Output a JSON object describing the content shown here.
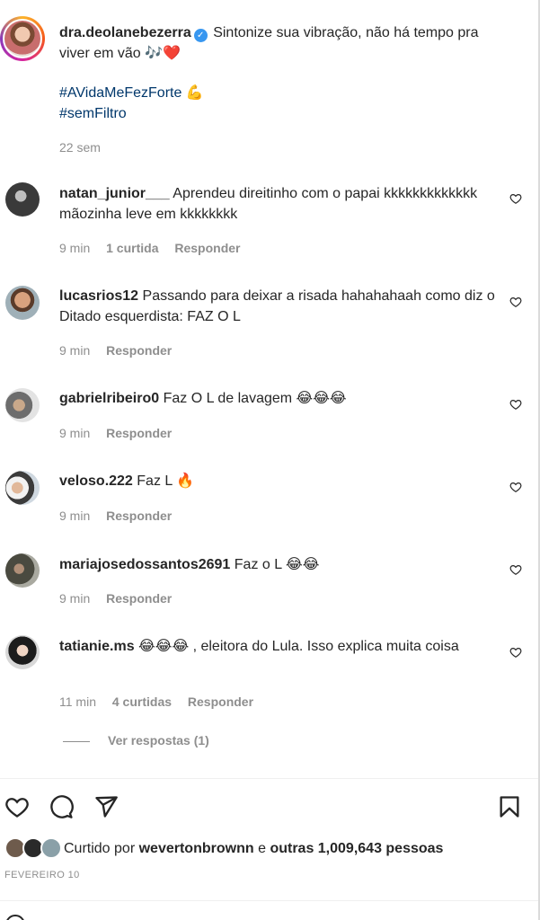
{
  "caption": {
    "username": "dra.deolanebezerra",
    "text": "Sintonize sua vibração, não há tempo pra viver em vão 🎶❤️",
    "hashtags": [
      "#AVidaMeFezForte 💪",
      "#semFiltro"
    ],
    "time": "22 sem"
  },
  "comments": [
    {
      "username": "natan_junior___",
      "text": "Aprendeu direitinho com o papai kkkkkkkkkkkkk mãozinha leve em kkkkkkkk",
      "time": "9 min",
      "likes": "1 curtida",
      "reply": "Responder"
    },
    {
      "username": "lucasrios12",
      "text": "Passando para deixar a risada hahahahaah como diz o Ditado esquerdista: FAZ O L",
      "time": "9 min",
      "likes": "",
      "reply": "Responder"
    },
    {
      "username": "gabrielribeiro0",
      "text": "Faz O L de lavagem 😂😂😂",
      "time": "9 min",
      "likes": "",
      "reply": "Responder"
    },
    {
      "username": "veloso.222",
      "text": "Faz L 🔥",
      "time": "9 min",
      "likes": "",
      "reply": "Responder"
    },
    {
      "username": "mariajosedossantos2691",
      "text": "Faz o L 😂😂",
      "time": "9 min",
      "likes": "",
      "reply": "Responder"
    },
    {
      "username": "tatianie.ms",
      "text": "😂😂😂 , eleitora do Lula. Isso explica muita coisa",
      "time": "11 min",
      "likes": "4 curtidas",
      "reply": "Responder"
    }
  ],
  "view_replies": "Ver respostas (1)",
  "likes": {
    "prefix": "Curtido por",
    "user": "wevertonbrownn",
    "conj": "e",
    "others": "outras 1,009,643 pessoas"
  },
  "date": "FEVEREIRO 10",
  "icons": [
    "heart-icon",
    "comment-icon",
    "share-icon",
    "bookmark-icon",
    "verified-badge-icon"
  ]
}
